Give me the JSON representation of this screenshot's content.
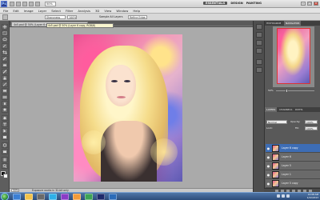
{
  "app": {
    "logo": "Ps",
    "zoom": "50%",
    "workspaces": [
      "ESSENTIALS",
      "DESIGN",
      "PAINTING"
    ],
    "active_workspace": "ESSENTIALS",
    "window_controls": [
      "–",
      "□",
      "×"
    ]
  },
  "menu": [
    "File",
    "Edit",
    "Image",
    "Layer",
    "Select",
    "Filter",
    "Analysis",
    "3D",
    "View",
    "Window",
    "Help"
  ],
  "options": {
    "field1": "Sharpness",
    "field2": "100%",
    "label1": "Sample All Layers",
    "label2": "Refine Edge..."
  },
  "document": {
    "tab_label": "4x5.psd @ 50% (Layer 6 copy, RGB/8) *",
    "tooltip": "4x5.psd @ 50% (Layer 6 copy, RGB/8)",
    "status_zoom": "50%",
    "status_text": "Exposure works in 32-bit only"
  },
  "navigator": {
    "tabs": [
      "HISTOGRAM",
      "NAVIGATOR"
    ],
    "active_tab": "NAVIGATOR",
    "zoom": "50%"
  },
  "layers_panel": {
    "tabs": [
      "LAYERS",
      "CHANNELS",
      "PATHS"
    ],
    "active_tab": "LAYERS",
    "blend_mode": "Normal",
    "opacity_label": "Opacity:",
    "opacity": "100%",
    "lock_label": "Lock:",
    "fill_label": "Fill:",
    "fill": "100%",
    "layers": [
      {
        "name": "Layer 6 copy",
        "selected": true
      },
      {
        "name": "Layer 6",
        "selected": false
      },
      {
        "name": "Layer 5",
        "selected": false
      },
      {
        "name": "Layer 1",
        "selected": false
      },
      {
        "name": "Layer 5 copy",
        "selected": false
      },
      {
        "name": "Background",
        "selected": false
      }
    ]
  },
  "taskbar": {
    "time": "12:08 AM",
    "date": "1/22/2013"
  },
  "colors": {
    "selected_layer": "#3d6db5",
    "panel": "#595959",
    "canvas_bg": "#aaaaaa"
  }
}
